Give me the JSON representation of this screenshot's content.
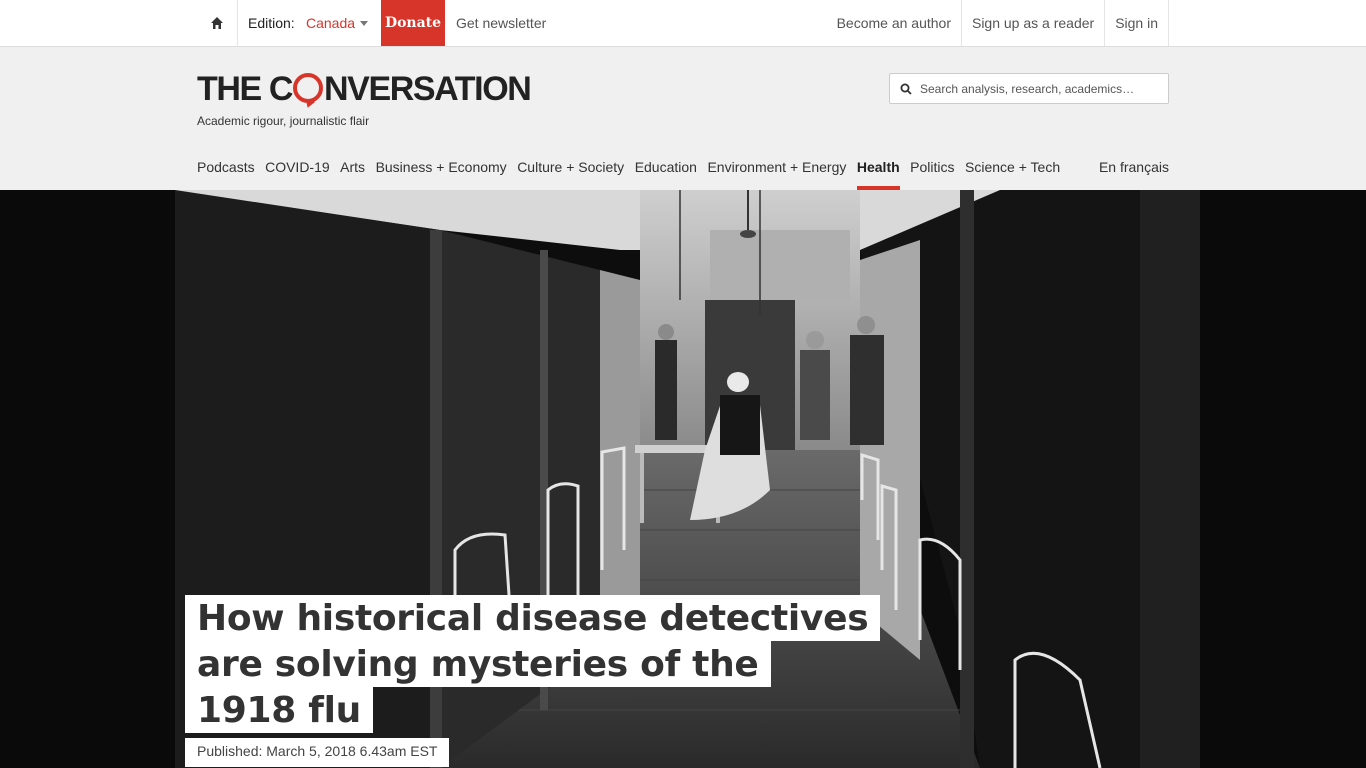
{
  "topbar": {
    "home_icon": "home-icon",
    "edition_label": "Edition:",
    "edition_value": "Canada",
    "donate": "Donate",
    "newsletter": "Get newsletter",
    "right_links": [
      "Become an author",
      "Sign up as a reader",
      "Sign in"
    ]
  },
  "header": {
    "logo": {
      "before": "THE C",
      "after": "NVERSATION"
    },
    "tagline": "Academic rigour, journalistic flair",
    "search_placeholder": "Search analysis, research, academics…",
    "nav": [
      "Podcasts",
      "COVID-19",
      "Arts",
      "Business + Economy",
      "Culture + Society",
      "Education",
      "Environment + Energy",
      "Health",
      "Politics",
      "Science + Tech"
    ],
    "nav_active": "Health",
    "francais": "En français"
  },
  "article": {
    "title_lines": [
      "How historical disease detectives",
      "are solving mysteries of the",
      "1918 flu"
    ],
    "published": "Published: March 5, 2018 6.43am EST"
  },
  "colors": {
    "brand_red": "#d8352a",
    "header_bg": "#f0f0f0",
    "text": "#333333"
  }
}
